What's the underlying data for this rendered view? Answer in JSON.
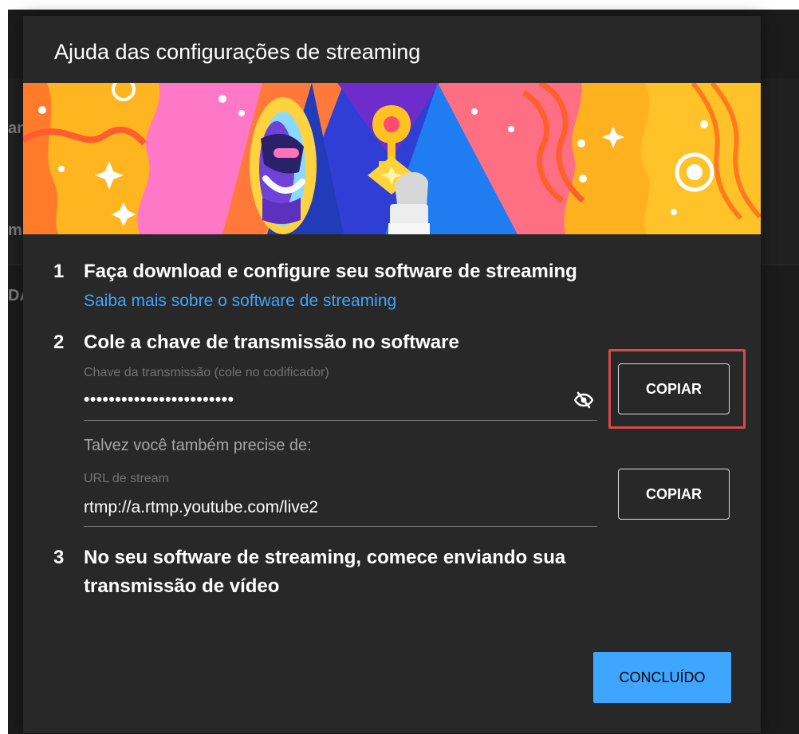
{
  "background": {
    "snippets": [
      "an",
      "mi",
      "DA"
    ]
  },
  "dialog": {
    "title": "Ajuda das configurações de streaming",
    "steps": [
      {
        "number": "1",
        "text": "Faça download e configure seu software de streaming",
        "link": "Saiba mais sobre o software de streaming"
      },
      {
        "number": "2",
        "text": "Cole a chave de transmissão no software"
      },
      {
        "number": "3",
        "text_line1": "No seu software de streaming, comece enviando sua",
        "text_line2": "transmissão de vídeo"
      }
    ],
    "stream_key": {
      "label": "Chave da transmissão (cole no codificador)",
      "value": "••••••••••••••••••••••••",
      "copy_label": "COPIAR",
      "visibility_icon": "eye-off-icon"
    },
    "helper_text": "Talvez você também precise de:",
    "stream_url": {
      "label": "URL de stream",
      "value": "rtmp://a.rtmp.youtube.com/live2",
      "copy_label": "COPIAR"
    },
    "done_label": "CONCLUÍDO"
  },
  "colors": {
    "dialog_background": "#282828",
    "accent_blue": "#3ea6ff",
    "highlight_red": "#d74b4b",
    "muted_text": "#737373"
  }
}
